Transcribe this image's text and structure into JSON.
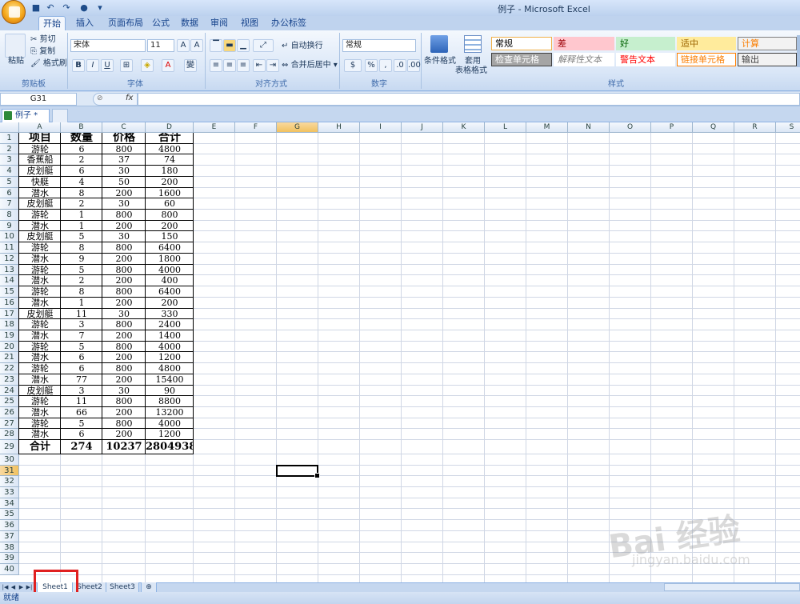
{
  "window": {
    "title": "例子 - Microsoft Excel"
  },
  "ribbon_tabs": [
    "开始",
    "插入",
    "页面布局",
    "公式",
    "数据",
    "审阅",
    "视图",
    "办公标签"
  ],
  "clipboard": {
    "paste": "粘贴",
    "cut": "剪切",
    "copy": "复制",
    "format_painter": "格式刷",
    "label": "剪贴板"
  },
  "font": {
    "name": "宋体",
    "size": "11",
    "label": "字体"
  },
  "alignment": {
    "wrap": "自动换行",
    "merge": "合并后居中",
    "label": "对齐方式"
  },
  "number": {
    "format": "常规",
    "label": "数字"
  },
  "styles": {
    "conditional": "条件格式",
    "table_line1": "套用",
    "table_line2": "表格格式",
    "cells": [
      {
        "text": "常规",
        "bg": "#ffffff",
        "color": "#000000",
        "border": "#f0b048"
      },
      {
        "text": "差",
        "bg": "#ffc7ce",
        "color": "#9c0006",
        "border": "#ffc7ce"
      },
      {
        "text": "好",
        "bg": "#c6efce",
        "color": "#006100",
        "border": "#c6efce"
      },
      {
        "text": "适中",
        "bg": "#ffeb9c",
        "color": "#9c6500",
        "border": "#ffeb9c"
      },
      {
        "text": "计算",
        "bg": "#f2f2f2",
        "color": "#fa7d00",
        "border": "#7f7f7f"
      },
      {
        "text": "检查单元格",
        "bg": "#a5a5a5",
        "color": "#ffffff",
        "border": "#3f3f3f"
      },
      {
        "text": "解释性文本",
        "bg": "#ffffff",
        "color": "#7f7f7f",
        "border": "#ffffff"
      },
      {
        "text": "警告文本",
        "bg": "#ffffff",
        "color": "#ff0000",
        "border": "#ffffff"
      },
      {
        "text": "链接单元格",
        "bg": "#ffffff",
        "color": "#fa7d00",
        "border": "#ff8001"
      },
      {
        "text": "输出",
        "bg": "#f2f2f2",
        "color": "#3f3f3f",
        "border": "#3f3f3f"
      }
    ],
    "label": "样式"
  },
  "name_box": "G31",
  "formula_bar": {
    "fx": "fx",
    "content": ""
  },
  "workbook_tab": "例子 *",
  "columns": [
    "A",
    "B",
    "C",
    "D",
    "E",
    "F",
    "G",
    "H",
    "I",
    "J",
    "K",
    "L",
    "M",
    "N",
    "O",
    "P",
    "Q",
    "R",
    "S"
  ],
  "table": {
    "headers": [
      "项目",
      "数量",
      "价格",
      "合计"
    ],
    "rows": [
      [
        "游轮",
        "6",
        "800",
        "4800"
      ],
      [
        "香蕉船",
        "2",
        "37",
        "74"
      ],
      [
        "皮划艇",
        "6",
        "30",
        "180"
      ],
      [
        "快艇",
        "4",
        "50",
        "200"
      ],
      [
        "潜水",
        "8",
        "200",
        "1600"
      ],
      [
        "皮划艇",
        "2",
        "30",
        "60"
      ],
      [
        "游轮",
        "1",
        "800",
        "800"
      ],
      [
        "潜水",
        "1",
        "200",
        "200"
      ],
      [
        "皮划艇",
        "5",
        "30",
        "150"
      ],
      [
        "游轮",
        "8",
        "800",
        "6400"
      ],
      [
        "潜水",
        "9",
        "200",
        "1800"
      ],
      [
        "游轮",
        "5",
        "800",
        "4000"
      ],
      [
        "潜水",
        "2",
        "200",
        "400"
      ],
      [
        "游轮",
        "8",
        "800",
        "6400"
      ],
      [
        "潜水",
        "1",
        "200",
        "200"
      ],
      [
        "皮划艇",
        "11",
        "30",
        "330"
      ],
      [
        "游轮",
        "3",
        "800",
        "2400"
      ],
      [
        "潜水",
        "7",
        "200",
        "1400"
      ],
      [
        "游轮",
        "5",
        "800",
        "4000"
      ],
      [
        "潜水",
        "6",
        "200",
        "1200"
      ],
      [
        "游轮",
        "6",
        "800",
        "4800"
      ],
      [
        "潜水",
        "77",
        "200",
        "15400"
      ],
      [
        "皮划艇",
        "3",
        "30",
        "90"
      ],
      [
        "游轮",
        "11",
        "800",
        "8800"
      ],
      [
        "潜水",
        "66",
        "200",
        "13200"
      ],
      [
        "游轮",
        "5",
        "800",
        "4000"
      ],
      [
        "潜水",
        "6",
        "200",
        "1200"
      ]
    ],
    "total": [
      "合计",
      "274",
      "10237",
      "2804938"
    ]
  },
  "selected_cell": {
    "column": "G",
    "row": 31
  },
  "visible_rows": 40,
  "sheet_tabs": [
    "Sheet1",
    "Sheet2",
    "Sheet3"
  ],
  "active_sheet": "Sheet1",
  "status": "就绪",
  "watermark": {
    "main": "Bai 经验",
    "sub": "jingyan.baidu.com"
  }
}
